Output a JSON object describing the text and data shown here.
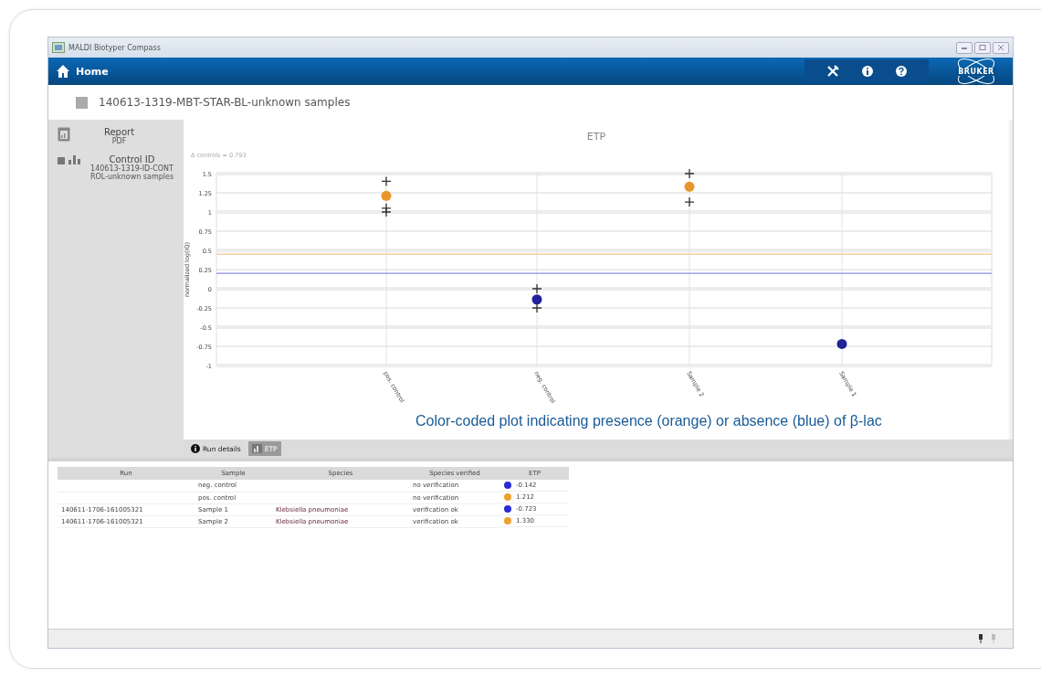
{
  "window": {
    "title": "MALDI Biotyper Compass"
  },
  "header": {
    "title": "Home",
    "logo": "BRUKER"
  },
  "run": {
    "title": "140613-1319-MBT-STAR-BL-unknown samples"
  },
  "sidebar": {
    "items": [
      {
        "kind": "report",
        "label": "Report",
        "sublabel": "PDF"
      },
      {
        "kind": "control",
        "label": "Control ID",
        "sublabel": "140613-1319-ID-CONTROL-unknown samples"
      }
    ]
  },
  "chart_panel": {
    "note": "Δ controls = 0.793",
    "chart_data": {
      "type": "scatter",
      "title": "ETP",
      "ylabel": "normalized log(IQ)",
      "categories": [
        "pos. control",
        "neg. control",
        "Sample 2",
        "Sample 1"
      ],
      "series": [
        {
          "color": "#e8952c",
          "values": [
            1.21,
            null,
            1.33,
            null
          ]
        },
        {
          "color": "#22229a",
          "values": [
            null,
            -0.14,
            null,
            -0.72
          ]
        },
        {
          "color": "#333333",
          "values": [
            1.4,
            0,
            1.5,
            null
          ]
        },
        {
          "color": "#333333",
          "values": [
            1.05,
            -0.25,
            1.13,
            null
          ]
        },
        {
          "color": "#333333",
          "values": [
            1.0,
            null,
            null,
            null
          ]
        }
      ],
      "ylim": [
        -1,
        1.5
      ],
      "yticks": [
        1.5,
        1.25,
        1,
        0.75,
        0.5,
        0.25,
        0,
        -0.25,
        -0.5,
        -0.75,
        -1
      ],
      "grid": true,
      "ref_lines": [
        {
          "axis": "y",
          "value": 0.45,
          "color": "#f2c48a"
        },
        {
          "axis": "y",
          "value": 0.2,
          "color": "#8c8ce6"
        }
      ]
    }
  },
  "caption": "Color-coded plot indicating presence (orange) or absence (blue) of β-lac",
  "tabs": [
    {
      "label": "Run details",
      "kind": "info",
      "selected": false
    },
    {
      "label": "ETP",
      "kind": "chart",
      "selected": true
    }
  ],
  "table": {
    "columns": [
      "Run",
      "Sample",
      "Species",
      "Species verified",
      "ETP"
    ],
    "rows": [
      {
        "sample": "neg. control",
        "verified": "no verification",
        "etp": "-0.142",
        "color": "#2b2bd6"
      },
      {
        "sample": "pos. control",
        "verified": "no verification",
        "etp": "1.212",
        "color": "#f0a030"
      },
      {
        "run": "140611-1706-161005321",
        "sample": "Sample 1",
        "species": "Klebsiella pneumoniae",
        "verified": "verification ok",
        "etp": "-0.723",
        "color": "#2b2bd6"
      },
      {
        "run": "140611-1706-161005321",
        "sample": "Sample 2",
        "species": "Klebsiella pneumoniae",
        "verified": "verification ok",
        "etp": "1.330",
        "color": "#f0a030"
      }
    ]
  }
}
